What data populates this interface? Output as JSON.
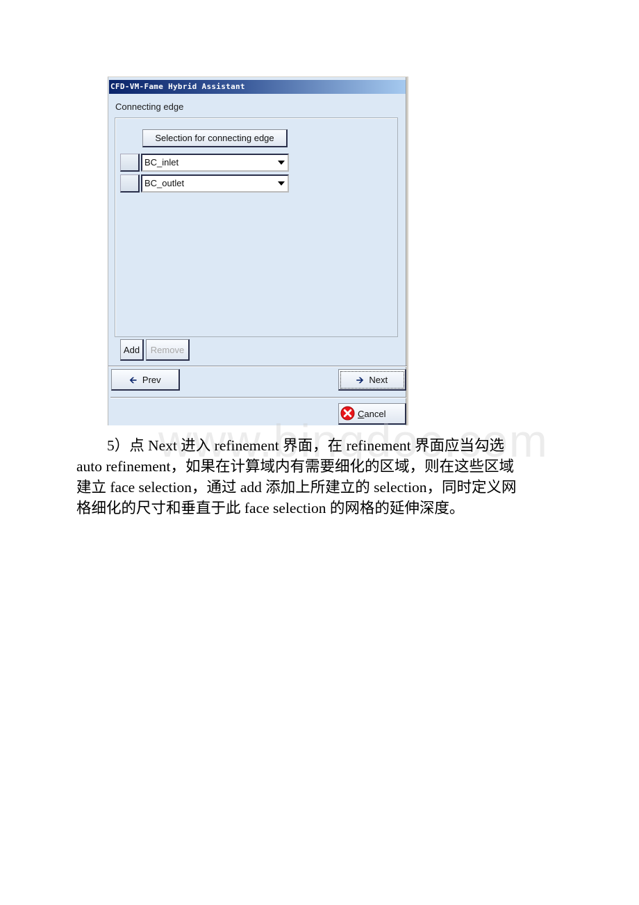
{
  "dialog": {
    "title": "CFD-VM-Fame Hybrid Assistant",
    "section_label": "Connecting edge",
    "selection_button": "Selection for connecting edge",
    "rows": [
      {
        "value": "BC_inlet"
      },
      {
        "value": "BC_outlet"
      }
    ],
    "add_label": "Add",
    "remove_label": "Remove",
    "prev_label": "Prev",
    "next_label": "Next",
    "cancel_label_first": "C",
    "cancel_label_rest": "ancel",
    "icons": {
      "prev": "arrow-left-icon",
      "next": "arrow-right-icon",
      "cancel": "error-x-icon"
    },
    "colors": {
      "title_start": "#0a246a",
      "title_end": "#a6caf0",
      "background": "#dce8f5",
      "cancel_icon": "#e8151b"
    }
  },
  "watermark": "www.bingdoc.com",
  "paragraph": {
    "lines": [
      "5）点 Next 进入 refinement 界面，在 refinement 界面应当勾选",
      "auto refinement，如果在计算域内有需要细化的区域，则在这些区域",
      "建立 face selection，通过 add 添加上所建立的 selection，同时定义网",
      "格细化的尺寸和垂直于此 face selection 的网格的延伸深度。"
    ]
  }
}
